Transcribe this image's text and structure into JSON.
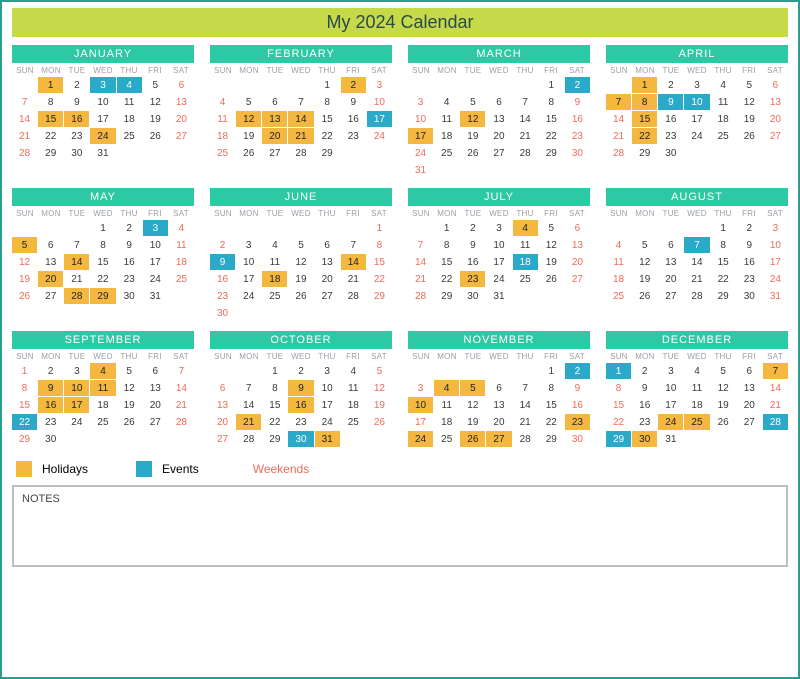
{
  "title": "My 2024 Calendar",
  "dow": [
    "SUN",
    "MON",
    "TUE",
    "WED",
    "THU",
    "FRI",
    "SAT"
  ],
  "legend": {
    "holidays": "Holidays",
    "events": "Events",
    "weekends": "Weekends"
  },
  "notes_label": "NOTES",
  "months": [
    {
      "name": "JANUARY",
      "start": 1,
      "days": 31,
      "holidays": [
        1,
        15,
        16,
        24
      ],
      "events": [
        3,
        4
      ]
    },
    {
      "name": "FEBRUARY",
      "start": 4,
      "days": 29,
      "holidays": [
        2,
        12,
        13,
        14,
        20,
        21
      ],
      "events": [
        17
      ]
    },
    {
      "name": "MARCH",
      "start": 5,
      "days": 31,
      "holidays": [
        12,
        17
      ],
      "events": [
        2
      ]
    },
    {
      "name": "APRIL",
      "start": 1,
      "days": 30,
      "holidays": [
        1,
        7,
        8,
        15,
        22
      ],
      "events": [
        9,
        10
      ]
    },
    {
      "name": "MAY",
      "start": 3,
      "days": 31,
      "holidays": [
        5,
        14,
        20,
        28,
        29
      ],
      "events": [
        3
      ]
    },
    {
      "name": "JUNE",
      "start": 6,
      "days": 30,
      "holidays": [
        14,
        18
      ],
      "events": [
        9
      ]
    },
    {
      "name": "JULY",
      "start": 1,
      "days": 31,
      "holidays": [
        4,
        23
      ],
      "events": [
        18
      ]
    },
    {
      "name": "AUGUST",
      "start": 4,
      "days": 31,
      "holidays": [],
      "events": [
        7
      ]
    },
    {
      "name": "SEPTEMBER",
      "start": 0,
      "days": 30,
      "holidays": [
        4,
        9,
        10,
        11,
        16,
        17
      ],
      "events": [
        22
      ]
    },
    {
      "name": "OCTOBER",
      "start": 2,
      "days": 31,
      "holidays": [
        9,
        16,
        21,
        31
      ],
      "events": [
        30
      ]
    },
    {
      "name": "NOVEMBER",
      "start": 5,
      "days": 30,
      "holidays": [
        4,
        5,
        10,
        23,
        24,
        26,
        27
      ],
      "events": [
        2
      ]
    },
    {
      "name": "DECEMBER",
      "start": 0,
      "days": 31,
      "holidays": [
        7,
        24,
        25,
        30
      ],
      "events": [
        1,
        28,
        29
      ]
    }
  ]
}
